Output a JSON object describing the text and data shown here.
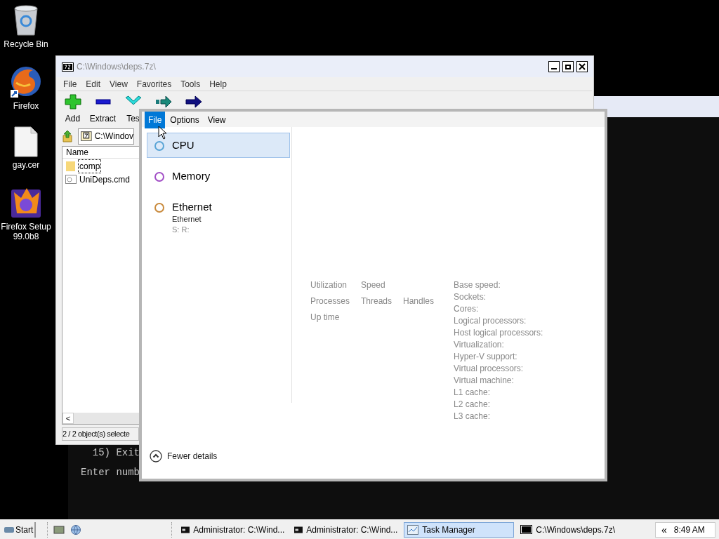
{
  "desktop_icons": [
    {
      "label": "Recycle Bin",
      "kind": "recycle"
    },
    {
      "label": "Firefox",
      "kind": "browser"
    },
    {
      "label": "gay.cer",
      "kind": "file"
    },
    {
      "label": "Firefox Setup 99.0b8",
      "kind": "installer"
    }
  ],
  "console": {
    "lines": [
      "  15) Exit",
      "Enter numb"
    ]
  },
  "archiver": {
    "title": "C:\\Windows\\deps.7z\\",
    "menu": [
      "File",
      "Edit",
      "View",
      "Favorites",
      "Tools",
      "Help"
    ],
    "toolbar": [
      {
        "label": "Add",
        "kind": "add"
      },
      {
        "label": "Extract",
        "kind": "extract"
      },
      {
        "label": "Tes",
        "kind": "test"
      },
      {
        "kind": "copy"
      },
      {
        "kind": "move"
      }
    ],
    "address": "C:\\Windov",
    "column": "Name",
    "files": [
      {
        "name": "comp",
        "kind": "folder",
        "selected": true
      },
      {
        "name": "UniDeps.cmd",
        "kind": "script",
        "selected": false
      }
    ],
    "scroll_left": "<",
    "status": "2 / 2 object(s) selecte"
  },
  "task_manager": {
    "menu": [
      {
        "label": "File",
        "selected": true
      },
      {
        "label": "Options",
        "selected": false
      },
      {
        "label": "View",
        "selected": false
      }
    ],
    "resources": [
      {
        "name": "CPU",
        "selected": true,
        "color": "#5aa5d6"
      },
      {
        "name": "Memory",
        "selected": false,
        "color": "#a24fc6"
      },
      {
        "name": "Ethernet",
        "selected": false,
        "color": "#c98a3c",
        "details": [
          "Ethernet",
          "S: R:"
        ]
      }
    ],
    "stats": [
      [
        "Utilization",
        "Speed"
      ],
      [
        "Processes",
        "Threads",
        "Handles"
      ],
      [
        "Up time"
      ]
    ],
    "specs": [
      "Base speed:",
      "Sockets:",
      "Cores:",
      "Logical processors:",
      "Host logical processors:",
      "Virtualization:",
      "Hyper-V support:",
      "Virtual processors:",
      "Virtual machine:",
      "L1 cache:",
      "L2 cache:",
      "L3 cache:"
    ],
    "footer": "Fewer details"
  },
  "taskbar": {
    "start": "Start",
    "tasks": [
      {
        "label": "Administrator: C:\\Wind...",
        "kind": "console",
        "selected": false
      },
      {
        "label": "Administrator: C:\\Wind...",
        "kind": "console",
        "selected": false
      },
      {
        "label": "Task Manager",
        "kind": "monitor",
        "selected": true
      },
      {
        "label": "C:\\Windows\\deps.7z\\",
        "kind": "archive",
        "selected": false
      }
    ],
    "tray_toggle": "«",
    "clock": "8:49 AM"
  }
}
